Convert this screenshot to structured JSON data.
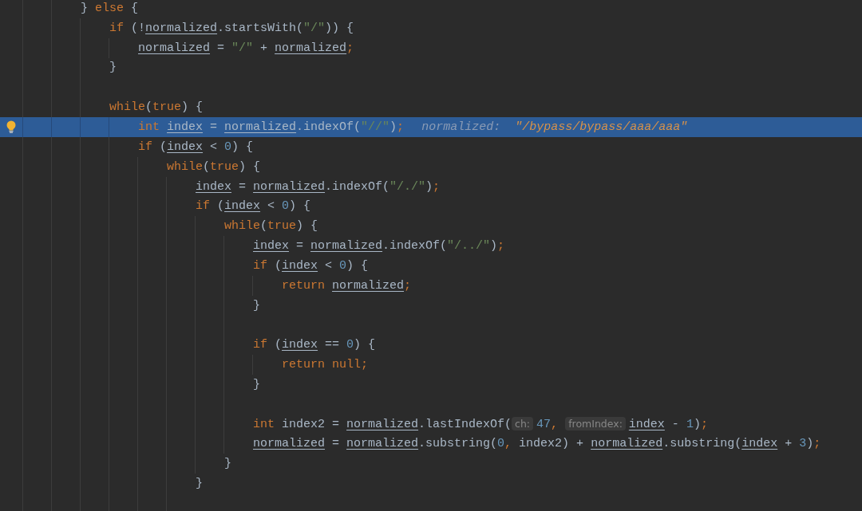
{
  "editor": {
    "lines": [
      {
        "current": false,
        "tokens": [
          {
            "kind": "plain",
            "text": "} "
          },
          {
            "kind": "keyword",
            "text": "else"
          },
          {
            "kind": "plain",
            "text": " {"
          }
        ],
        "children": [
          {
            "current": false,
            "tokens": [
              {
                "kind": "keyword",
                "text": "if"
              },
              {
                "kind": "plain",
                "text": " (!"
              },
              {
                "kind": "var",
                "text": "normalized"
              },
              {
                "kind": "plain",
                "text": ".startsWith("
              },
              {
                "kind": "string",
                "text": "\"/\""
              },
              {
                "kind": "plain",
                "text": ")) {"
              }
            ],
            "children": [
              {
                "current": false,
                "tokens": [
                  {
                    "kind": "var",
                    "text": "normalized"
                  },
                  {
                    "kind": "plain",
                    "text": " = "
                  },
                  {
                    "kind": "string",
                    "text": "\"/\""
                  },
                  {
                    "kind": "plain",
                    "text": " + "
                  },
                  {
                    "kind": "var",
                    "text": "normalized"
                  },
                  {
                    "kind": "punct",
                    "text": ";"
                  }
                ]
              }
            ]
          },
          {
            "current": false,
            "tokens": [
              {
                "kind": "plain",
                "text": "}"
              }
            ]
          },
          {
            "current": false
          },
          {
            "current": false,
            "tokens": [
              {
                "kind": "keyword",
                "text": "while"
              },
              {
                "kind": "plain",
                "text": "("
              },
              {
                "kind": "keyword",
                "text": "true"
              },
              {
                "kind": "plain",
                "text": ") {"
              }
            ],
            "children": [
              {
                "current": true,
                "tokens": [
                  {
                    "kind": "keyword",
                    "text": "int "
                  },
                  {
                    "kind": "var",
                    "text": "index"
                  },
                  {
                    "kind": "plain",
                    "text": " = "
                  },
                  {
                    "kind": "var",
                    "text": "normalized"
                  },
                  {
                    "kind": "plain",
                    "text": ".indexOf("
                  },
                  {
                    "kind": "string",
                    "text": "\"//\""
                  },
                  {
                    "kind": "plain",
                    "text": ")"
                  },
                  {
                    "kind": "punct",
                    "text": ";"
                  }
                ],
                "debug": {
                  "label": "normalized:",
                  "value": "\"/bypass/bypass/aaa/aaa\""
                }
              },
              {
                "current": false,
                "tokens": [
                  {
                    "kind": "keyword",
                    "text": "if"
                  },
                  {
                    "kind": "plain",
                    "text": " ("
                  },
                  {
                    "kind": "var",
                    "text": "index"
                  },
                  {
                    "kind": "plain",
                    "text": " < "
                  },
                  {
                    "kind": "number",
                    "text": "0"
                  },
                  {
                    "kind": "plain",
                    "text": ") {"
                  }
                ],
                "children": [
                  {
                    "current": false,
                    "tokens": [
                      {
                        "kind": "keyword",
                        "text": "while"
                      },
                      {
                        "kind": "plain",
                        "text": "("
                      },
                      {
                        "kind": "keyword",
                        "text": "true"
                      },
                      {
                        "kind": "plain",
                        "text": ") {"
                      }
                    ],
                    "children": [
                      {
                        "current": false,
                        "tokens": [
                          {
                            "kind": "var",
                            "text": "index"
                          },
                          {
                            "kind": "plain",
                            "text": " = "
                          },
                          {
                            "kind": "var",
                            "text": "normalized"
                          },
                          {
                            "kind": "plain",
                            "text": ".indexOf("
                          },
                          {
                            "kind": "string",
                            "text": "\"/./\""
                          },
                          {
                            "kind": "plain",
                            "text": ")"
                          },
                          {
                            "kind": "punct",
                            "text": ";"
                          }
                        ]
                      },
                      {
                        "current": false,
                        "tokens": [
                          {
                            "kind": "keyword",
                            "text": "if"
                          },
                          {
                            "kind": "plain",
                            "text": " ("
                          },
                          {
                            "kind": "var",
                            "text": "index"
                          },
                          {
                            "kind": "plain",
                            "text": " < "
                          },
                          {
                            "kind": "number",
                            "text": "0"
                          },
                          {
                            "kind": "plain",
                            "text": ") {"
                          }
                        ],
                        "children": [
                          {
                            "current": false,
                            "tokens": [
                              {
                                "kind": "keyword",
                                "text": "while"
                              },
                              {
                                "kind": "plain",
                                "text": "("
                              },
                              {
                                "kind": "keyword",
                                "text": "true"
                              },
                              {
                                "kind": "plain",
                                "text": ") {"
                              }
                            ],
                            "children": [
                              {
                                "current": false,
                                "tokens": [
                                  {
                                    "kind": "var",
                                    "text": "index"
                                  },
                                  {
                                    "kind": "plain",
                                    "text": " = "
                                  },
                                  {
                                    "kind": "var",
                                    "text": "normalized"
                                  },
                                  {
                                    "kind": "plain",
                                    "text": ".indexOf("
                                  },
                                  {
                                    "kind": "string",
                                    "text": "\"/../\""
                                  },
                                  {
                                    "kind": "plain",
                                    "text": ")"
                                  },
                                  {
                                    "kind": "punct",
                                    "text": ";"
                                  }
                                ]
                              },
                              {
                                "current": false,
                                "tokens": [
                                  {
                                    "kind": "keyword",
                                    "text": "if"
                                  },
                                  {
                                    "kind": "plain",
                                    "text": " ("
                                  },
                                  {
                                    "kind": "var",
                                    "text": "index"
                                  },
                                  {
                                    "kind": "plain",
                                    "text": " < "
                                  },
                                  {
                                    "kind": "number",
                                    "text": "0"
                                  },
                                  {
                                    "kind": "plain",
                                    "text": ") {"
                                  }
                                ],
                                "children": [
                                  {
                                    "current": false,
                                    "tokens": [
                                      {
                                        "kind": "keyword",
                                        "text": "return "
                                      },
                                      {
                                        "kind": "var",
                                        "text": "normalized"
                                      },
                                      {
                                        "kind": "punct",
                                        "text": ";"
                                      }
                                    ]
                                  }
                                ]
                              },
                              {
                                "current": false,
                                "tokens": [
                                  {
                                    "kind": "plain",
                                    "text": "}"
                                  }
                                ]
                              },
                              {
                                "current": false
                              },
                              {
                                "current": false,
                                "tokens": [
                                  {
                                    "kind": "keyword",
                                    "text": "if"
                                  },
                                  {
                                    "kind": "plain",
                                    "text": " ("
                                  },
                                  {
                                    "kind": "var",
                                    "text": "index"
                                  },
                                  {
                                    "kind": "plain",
                                    "text": " == "
                                  },
                                  {
                                    "kind": "number",
                                    "text": "0"
                                  },
                                  {
                                    "kind": "plain",
                                    "text": ") {"
                                  }
                                ],
                                "children": [
                                  {
                                    "current": false,
                                    "tokens": [
                                      {
                                        "kind": "keyword",
                                        "text": "return null"
                                      },
                                      {
                                        "kind": "punct",
                                        "text": ";"
                                      }
                                    ]
                                  }
                                ]
                              },
                              {
                                "current": false,
                                "tokens": [
                                  {
                                    "kind": "plain",
                                    "text": "}"
                                  }
                                ]
                              },
                              {
                                "current": false
                              },
                              {
                                "current": false,
                                "tokens": [
                                  {
                                    "kind": "keyword",
                                    "text": "int"
                                  },
                                  {
                                    "kind": "plain",
                                    "text": " index2 = "
                                  },
                                  {
                                    "kind": "var",
                                    "text": "normalized"
                                  },
                                  {
                                    "kind": "plain",
                                    "text": ".lastIndexOf("
                                  },
                                  {
                                    "kind": "hint",
                                    "text": "ch:"
                                  },
                                  {
                                    "kind": "number",
                                    "text": "47"
                                  },
                                  {
                                    "kind": "punct",
                                    "text": ", "
                                  },
                                  {
                                    "kind": "hint",
                                    "text": "fromIndex:"
                                  },
                                  {
                                    "kind": "var",
                                    "text": "index"
                                  },
                                  {
                                    "kind": "plain",
                                    "text": " - "
                                  },
                                  {
                                    "kind": "number",
                                    "text": "1"
                                  },
                                  {
                                    "kind": "plain",
                                    "text": ")"
                                  },
                                  {
                                    "kind": "punct",
                                    "text": ";"
                                  }
                                ]
                              },
                              {
                                "current": false,
                                "tokens": [
                                  {
                                    "kind": "var",
                                    "text": "normalized"
                                  },
                                  {
                                    "kind": "plain",
                                    "text": " = "
                                  },
                                  {
                                    "kind": "var",
                                    "text": "normalized"
                                  },
                                  {
                                    "kind": "plain",
                                    "text": ".substring("
                                  },
                                  {
                                    "kind": "number",
                                    "text": "0"
                                  },
                                  {
                                    "kind": "punct",
                                    "text": ","
                                  },
                                  {
                                    "kind": "plain",
                                    "text": " index2) + "
                                  },
                                  {
                                    "kind": "var",
                                    "text": "normalized"
                                  },
                                  {
                                    "kind": "plain",
                                    "text": ".substring("
                                  },
                                  {
                                    "kind": "var",
                                    "text": "index"
                                  },
                                  {
                                    "kind": "plain",
                                    "text": " + "
                                  },
                                  {
                                    "kind": "number",
                                    "text": "3"
                                  },
                                  {
                                    "kind": "plain",
                                    "text": ")"
                                  },
                                  {
                                    "kind": "punct",
                                    "text": ";"
                                  }
                                ]
                              }
                            ]
                          },
                          {
                            "current": false,
                            "tokens": [
                              {
                                "kind": "plain",
                                "text": "}"
                              }
                            ]
                          }
                        ]
                      },
                      {
                        "current": false,
                        "tokens": [
                          {
                            "kind": "plain",
                            "text": "}"
                          }
                        ]
                      },
                      {
                        "current": false
                      }
                    ]
                  }
                ]
              }
            ]
          }
        ]
      }
    ]
  }
}
